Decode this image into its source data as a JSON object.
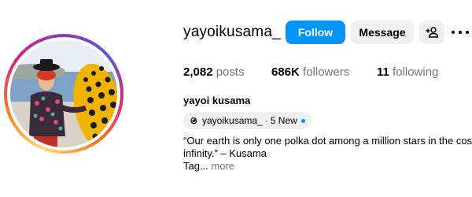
{
  "profile": {
    "username": "yayoikusama_",
    "full_name": "yayoi kusama",
    "avatar_alt": "profile picture"
  },
  "actions": {
    "follow_label": "Follow",
    "message_label": "Message",
    "suggest_icon": "add-person-icon",
    "more_icon": "more-icon"
  },
  "stats": {
    "posts_count": "2,082",
    "posts_label": "posts",
    "followers_count": "686K",
    "followers_label": "followers",
    "following_count": "11",
    "following_label": "following"
  },
  "threads": {
    "handle": "yayoikusama_",
    "separator": "·",
    "new_label": "5 New",
    "icon": "threads-icon"
  },
  "bio": {
    "line1": "“Our earth is only one polka dot among a million stars in the cosm",
    "line2": "infinity.” – Kusama",
    "line3_prefix": "Tag...",
    "more_label": "more"
  },
  "colors": {
    "follow_bg": "#0095f6",
    "button_bg": "#efefef",
    "muted_text": "#737373"
  }
}
